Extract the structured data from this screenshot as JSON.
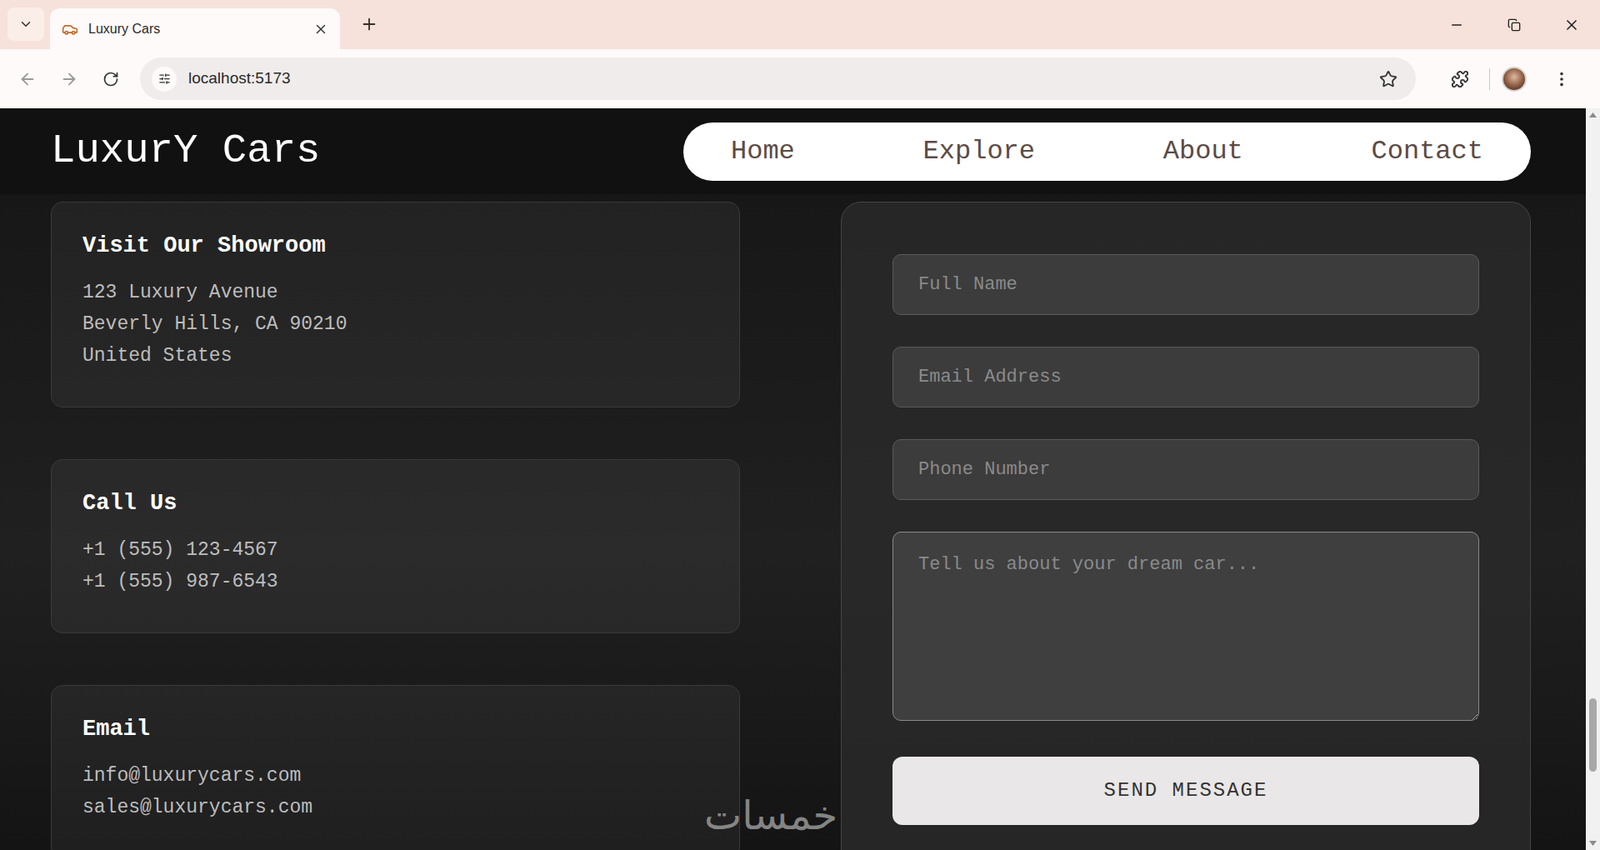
{
  "browser": {
    "tab_title": "Luxury Cars",
    "url": "localhost:5173"
  },
  "header": {
    "logo": "LuxurY Cars",
    "nav": [
      {
        "label": "Home"
      },
      {
        "label": "Explore"
      },
      {
        "label": "About"
      },
      {
        "label": "Contact"
      }
    ]
  },
  "info_cards": [
    {
      "title": "Visit Our Showroom",
      "lines": [
        "123 Luxury Avenue",
        "Beverly Hills, CA 90210",
        "United States"
      ]
    },
    {
      "title": "Call Us",
      "lines": [
        "+1 (555) 123-4567",
        "+1 (555) 987-6543"
      ]
    },
    {
      "title": "Email",
      "lines": [
        "info@luxurycars.com",
        "sales@luxurycars.com"
      ]
    }
  ],
  "form": {
    "fields": [
      {
        "kind": "input",
        "placeholder": "Full Name",
        "focused": false
      },
      {
        "kind": "input",
        "placeholder": "Email Address",
        "focused": false
      },
      {
        "kind": "input",
        "placeholder": "Phone Number",
        "focused": false
      },
      {
        "kind": "textarea",
        "placeholder": "Tell us about your dream car...",
        "focused": true
      }
    ],
    "button": "SEND MESSAGE"
  },
  "watermark": "خمسات",
  "scrollbar": {
    "level": 0.9
  }
}
